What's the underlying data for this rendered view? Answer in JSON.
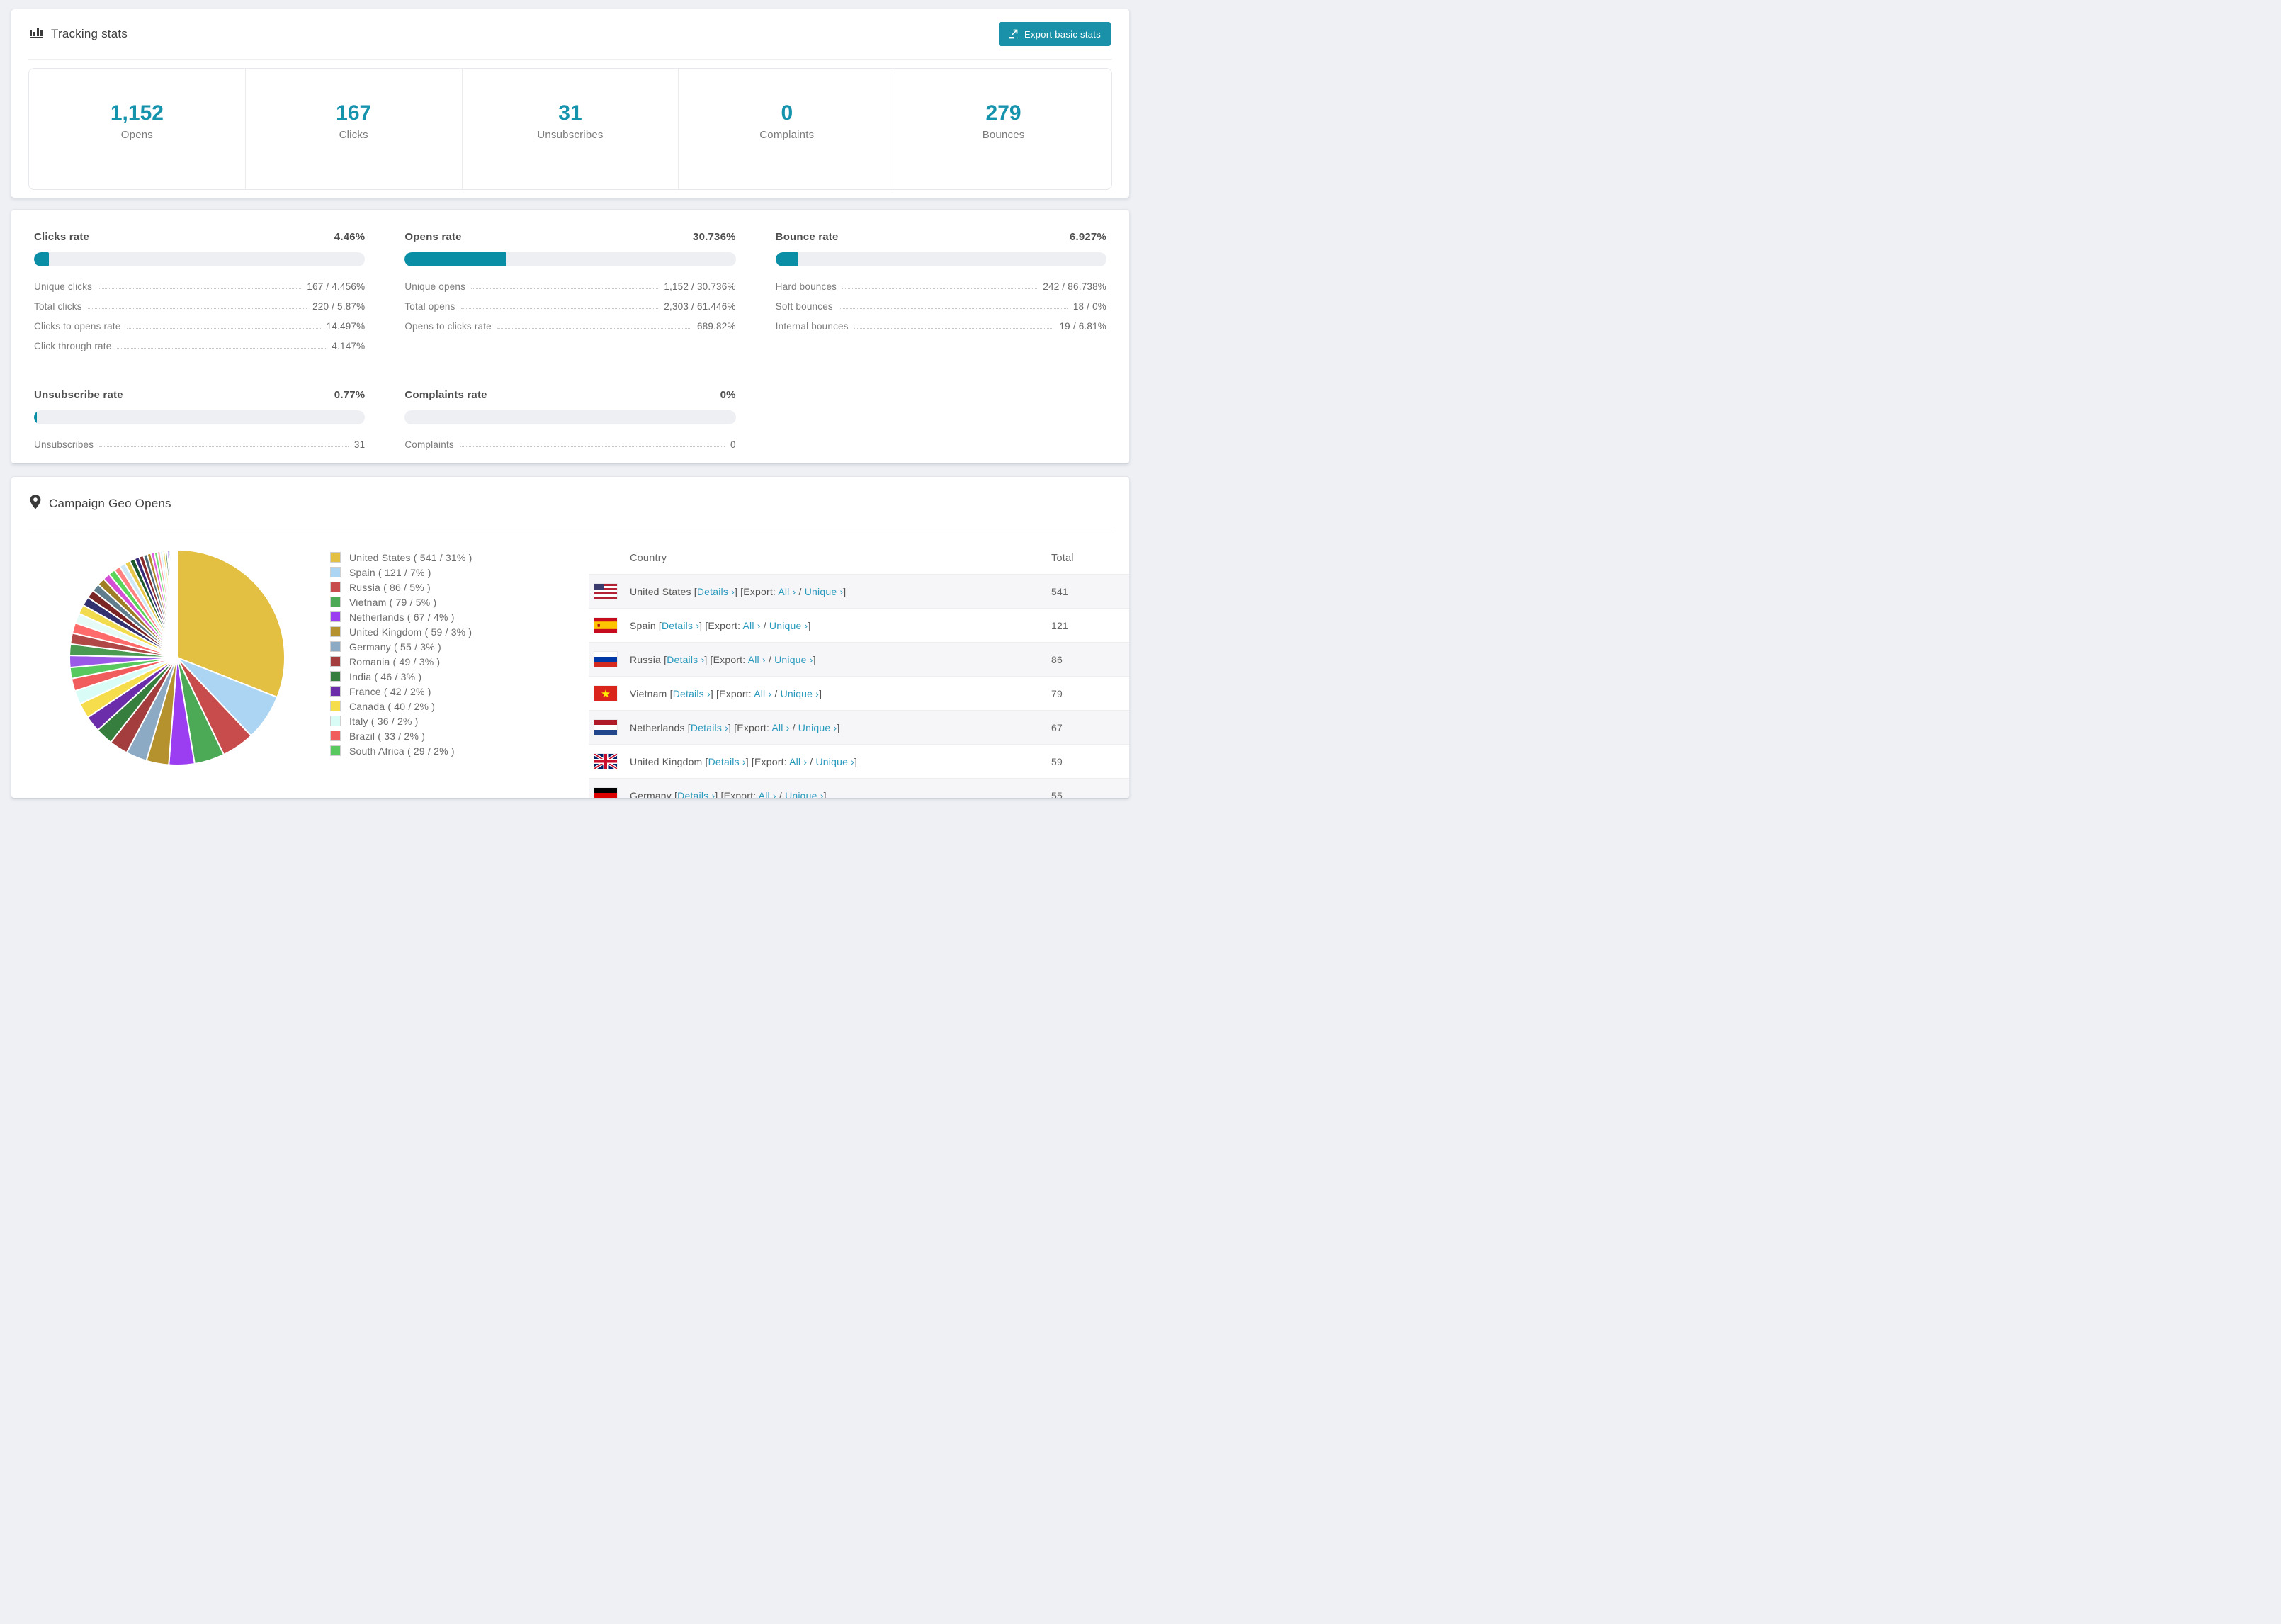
{
  "tracking": {
    "title": "Tracking stats",
    "export_button": "Export basic stats",
    "stats": [
      {
        "value": "1,152",
        "label": "Opens"
      },
      {
        "value": "167",
        "label": "Clicks"
      },
      {
        "value": "31",
        "label": "Unsubscribes"
      },
      {
        "value": "0",
        "label": "Complaints"
      },
      {
        "value": "279",
        "label": "Bounces"
      }
    ]
  },
  "rates": [
    {
      "title": "Clicks rate",
      "value": "4.46%",
      "percent": 4.46,
      "rows": [
        {
          "label": "Unique clicks",
          "value": "167 / 4.456%"
        },
        {
          "label": "Total clicks",
          "value": "220 / 5.87%"
        },
        {
          "label": "Clicks to opens rate",
          "value": "14.497%"
        },
        {
          "label": "Click through rate",
          "value": "4.147%"
        }
      ]
    },
    {
      "title": "Opens rate",
      "value": "30.736%",
      "percent": 30.736,
      "rows": [
        {
          "label": "Unique opens",
          "value": "1,152 / 30.736%"
        },
        {
          "label": "Total opens",
          "value": "2,303 / 61.446%"
        },
        {
          "label": "Opens to clicks rate",
          "value": "689.82%"
        }
      ]
    },
    {
      "title": "Bounce rate",
      "value": "6.927%",
      "percent": 6.927,
      "rows": [
        {
          "label": "Hard bounces",
          "value": "242 / 86.738%"
        },
        {
          "label": "Soft bounces",
          "value": "18 / 0%"
        },
        {
          "label": "Internal bounces",
          "value": "19 / 6.81%"
        }
      ]
    },
    {
      "title": "Unsubscribe rate",
      "value": "0.77%",
      "percent": 0.77,
      "rows": [
        {
          "label": "Unsubscribes",
          "value": "31"
        }
      ]
    },
    {
      "title": "Complaints rate",
      "value": "0%",
      "percent": 0,
      "rows": [
        {
          "label": "Complaints",
          "value": "0"
        }
      ]
    }
  ],
  "geo": {
    "title": "Campaign Geo Opens",
    "links": {
      "details": "Details ›",
      "export": "Export:",
      "all": "All ›",
      "unique": "Unique ›"
    },
    "table": {
      "columns": [
        "Country",
        "Total"
      ],
      "rows": [
        {
          "country": "United States",
          "flag": "us",
          "total": "541"
        },
        {
          "country": "Spain",
          "flag": "es",
          "total": "121"
        },
        {
          "country": "Russia",
          "flag": "ru",
          "total": "86"
        },
        {
          "country": "Vietnam",
          "flag": "vn",
          "total": "79"
        },
        {
          "country": "Netherlands",
          "flag": "nl",
          "total": "67"
        },
        {
          "country": "United Kingdom",
          "flag": "gb",
          "total": "59"
        },
        {
          "country": "Germany",
          "flag": "de",
          "total": "55"
        }
      ]
    }
  },
  "chart_data": {
    "type": "pie",
    "title": "Campaign Geo Opens",
    "legend_position": "right",
    "start_angle_deg": 0,
    "direction": "clockwise",
    "total_value": 1745,
    "slices": [
      {
        "label": "United States",
        "value": 541,
        "pct": 31,
        "color": "#e3bf42"
      },
      {
        "label": "Spain",
        "value": 121,
        "pct": 7,
        "color": "#abd5f3"
      },
      {
        "label": "Russia",
        "value": 86,
        "pct": 5,
        "color": "#c84c4c"
      },
      {
        "label": "Vietnam",
        "value": 79,
        "pct": 5,
        "color": "#4caa57"
      },
      {
        "label": "Netherlands",
        "value": 67,
        "pct": 4,
        "color": "#9b3df0"
      },
      {
        "label": "United Kingdom",
        "value": 59,
        "pct": 3,
        "color": "#b5922d"
      },
      {
        "label": "Germany",
        "value": 55,
        "pct": 3,
        "color": "#8caac4"
      },
      {
        "label": "Romania",
        "value": 49,
        "pct": 3,
        "color": "#a43d3d"
      },
      {
        "label": "India",
        "value": 46,
        "pct": 3,
        "color": "#357e3e"
      },
      {
        "label": "France",
        "value": 42,
        "pct": 2,
        "color": "#6b2daa"
      },
      {
        "label": "Canada",
        "value": 40,
        "pct": 2,
        "color": "#f6dd4c"
      },
      {
        "label": "Italy",
        "value": 36,
        "pct": 2,
        "color": "#d9fcf7"
      },
      {
        "label": "Brazil",
        "value": 33,
        "pct": 2,
        "color": "#f15d5d"
      },
      {
        "label": "South Africa",
        "value": 29,
        "pct": 2,
        "color": "#58c95f"
      }
    ],
    "others": {
      "note": "remaining small countries, unlabeled thin slices",
      "total_value": 462,
      "slice_count": 40,
      "palette": [
        "#9b59e8",
        "#4a9a52",
        "#b04848",
        "#ff6b6b",
        "#e6fbf6",
        "#f2dc4e",
        "#32306e",
        "#7a2424",
        "#5f7d8c",
        "#9e7d24",
        "#d44fd4",
        "#5ad45a",
        "#ff8080",
        "#cfe8f8",
        "#e8c84a",
        "#1e5a30",
        "#3a2a7a",
        "#8a2a2a",
        "#4a6a7a",
        "#b08a2a",
        "#e060e0",
        "#70e070",
        "#ffa0a0",
        "#d0f0ff",
        "#f0d860",
        "#2a6a3a"
      ]
    }
  }
}
